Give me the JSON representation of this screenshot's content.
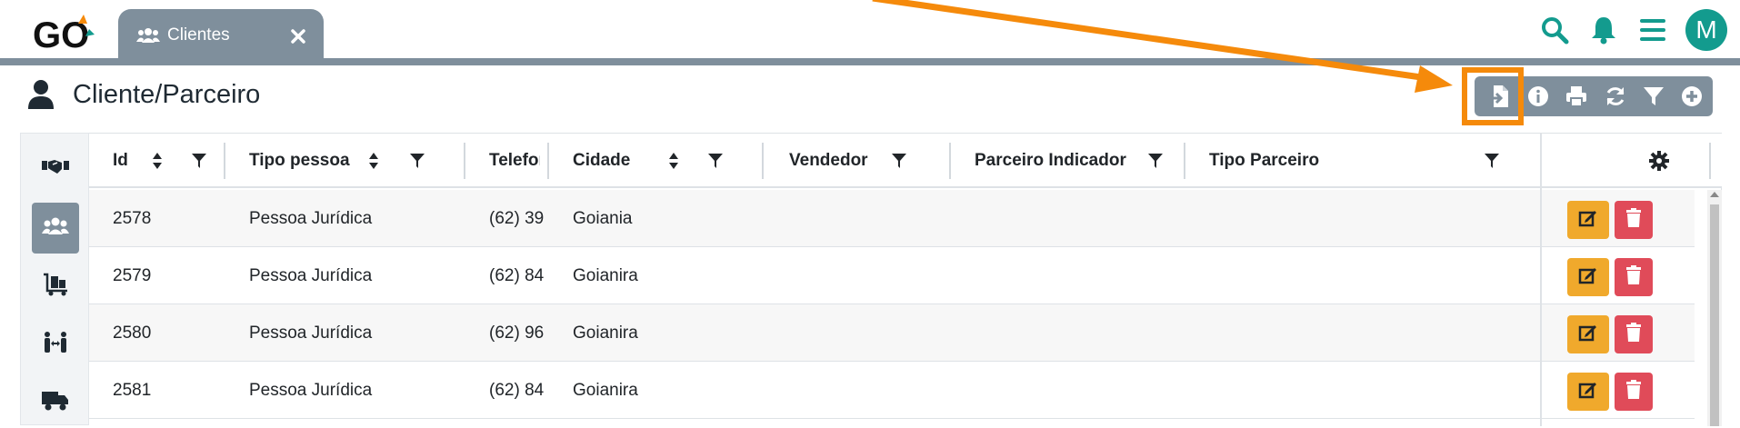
{
  "app": {
    "logo_text": "GO"
  },
  "tab": {
    "label": "Clientes",
    "icon": "users-icon"
  },
  "header_icons": [
    "search-icon",
    "bell-icon",
    "menu-icon"
  ],
  "user": {
    "avatar_initial": "M"
  },
  "page": {
    "title": "Cliente/Parceiro",
    "icon": "user-icon"
  },
  "toolbar": [
    "import-icon",
    "info-icon",
    "print-icon",
    "refresh-icon",
    "filter-icon",
    "add-icon"
  ],
  "sidebar": {
    "items": [
      {
        "icon": "handshake-icon",
        "active": false
      },
      {
        "icon": "users-icon",
        "active": true
      },
      {
        "icon": "dolly-icon",
        "active": false
      },
      {
        "icon": "people-arrows-icon",
        "active": false
      },
      {
        "icon": "truck-icon",
        "active": false
      }
    ]
  },
  "table": {
    "columns": [
      "Id",
      "Tipo pessoa",
      "Telefone",
      "Cidade",
      "Vendedor",
      "Parceiro Indicador",
      "Tipo Parceiro"
    ],
    "rows": [
      {
        "id": "2578",
        "tipo": "Pessoa Jurídica",
        "telefone": "(62) 39",
        "cidade": "Goiania",
        "vendedor": "",
        "indicador": "",
        "tipo_parceiro": ""
      },
      {
        "id": "2579",
        "tipo": "Pessoa Jurídica",
        "telefone": "(62) 84",
        "cidade": "Goianira",
        "vendedor": "",
        "indicador": "",
        "tipo_parceiro": ""
      },
      {
        "id": "2580",
        "tipo": "Pessoa Jurídica",
        "telefone": "(62) 96",
        "cidade": "Goianira",
        "vendedor": "",
        "indicador": "",
        "tipo_parceiro": ""
      },
      {
        "id": "2581",
        "tipo": "Pessoa Jurídica",
        "telefone": "(62) 84",
        "cidade": "Goianira",
        "vendedor": "",
        "indicador": "",
        "tipo_parceiro": ""
      }
    ]
  },
  "colors": {
    "accent": "#139b8e",
    "bar": "#7f8f9c",
    "highlight": "#f58a0b",
    "edit": "#f0a92c",
    "delete": "#e04b59"
  }
}
